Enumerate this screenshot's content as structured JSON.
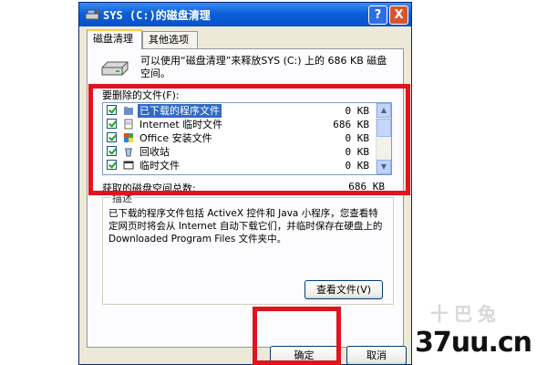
{
  "window": {
    "title": "SYS (C:)的磁盘清理",
    "help_button": "?",
    "close_button": "X"
  },
  "tabs": [
    {
      "label": "磁盘清理",
      "active": true
    },
    {
      "label": "其他选项",
      "active": false
    }
  ],
  "intro_text": "可以使用“磁盘清理”来释放SYS (C:) 上的 686 KB 磁盘空间。",
  "files_section_label": "要删除的文件(F):",
  "files": [
    {
      "name": "已下载的程序文件",
      "size": "0 KB",
      "checked": true,
      "selected": true,
      "icon": "folder-icon"
    },
    {
      "name": "Internet 临时文件",
      "size": "686 KB",
      "checked": true,
      "selected": false,
      "icon": "internet-files-icon"
    },
    {
      "name": "Office 安装文件",
      "size": "0 KB",
      "checked": true,
      "selected": false,
      "icon": "office-icon"
    },
    {
      "name": "回收站",
      "size": "0 KB",
      "checked": true,
      "selected": false,
      "icon": "recycle-bin-icon"
    },
    {
      "name": "临时文件",
      "size": "0 KB",
      "checked": true,
      "selected": false,
      "icon": "temp-files-icon"
    }
  ],
  "total": {
    "label": "获取的磁盘空间总数:",
    "value": "686 KB"
  },
  "description": {
    "legend": "描述",
    "text": "已下载的程序文件包括 ActiveX 控件和 Java 小程序，您查看特定网页时将会从 Internet 自动下载它们，并临时保存在硬盘上的 Downloaded Program Files 文件夹中。"
  },
  "buttons": {
    "view_files": "查看文件(V)",
    "ok": "确定",
    "cancel": "取消"
  },
  "watermark": {
    "site": "37uu.cn",
    "logo_text": "十巴兔"
  },
  "colors": {
    "highlight": "#e0141e",
    "title_bar": "#0a5fd8",
    "selection": "#316ac5"
  }
}
